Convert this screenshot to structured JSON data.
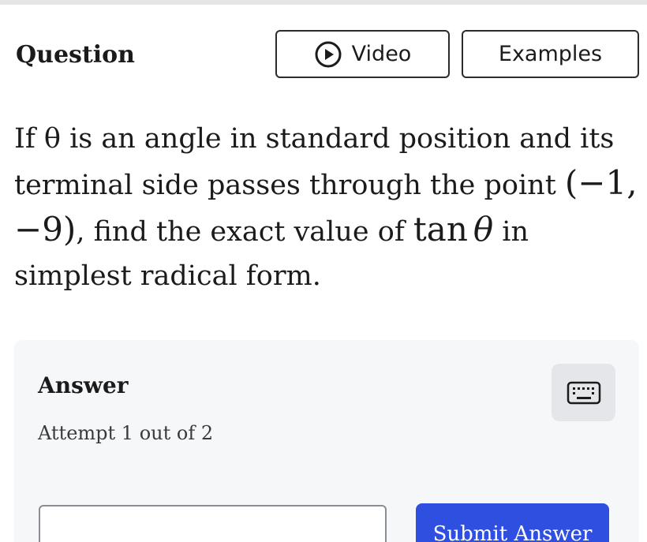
{
  "header": {
    "title": "Question",
    "video_label": "Video",
    "examples_label": "Examples"
  },
  "question": {
    "text_1": "If θ is an angle in standard position and its terminal side passes through the point ",
    "point": "(−1, −9)",
    "text_2": ", find the exact value of ",
    "tan": "tan",
    "theta": "θ",
    "text_3": " in simplest radical form."
  },
  "answer": {
    "title": "Answer",
    "attempt": "Attempt 1 out of 2",
    "input_value": "",
    "submit_label": "Submit Answer"
  },
  "icons": {
    "video": "play-circle-icon",
    "keyboard": "keyboard-icon"
  },
  "colors": {
    "primary": "#2e4fe0",
    "panel_bg": "#f6f7f8",
    "keyboard_bg": "#e4e6ea"
  }
}
